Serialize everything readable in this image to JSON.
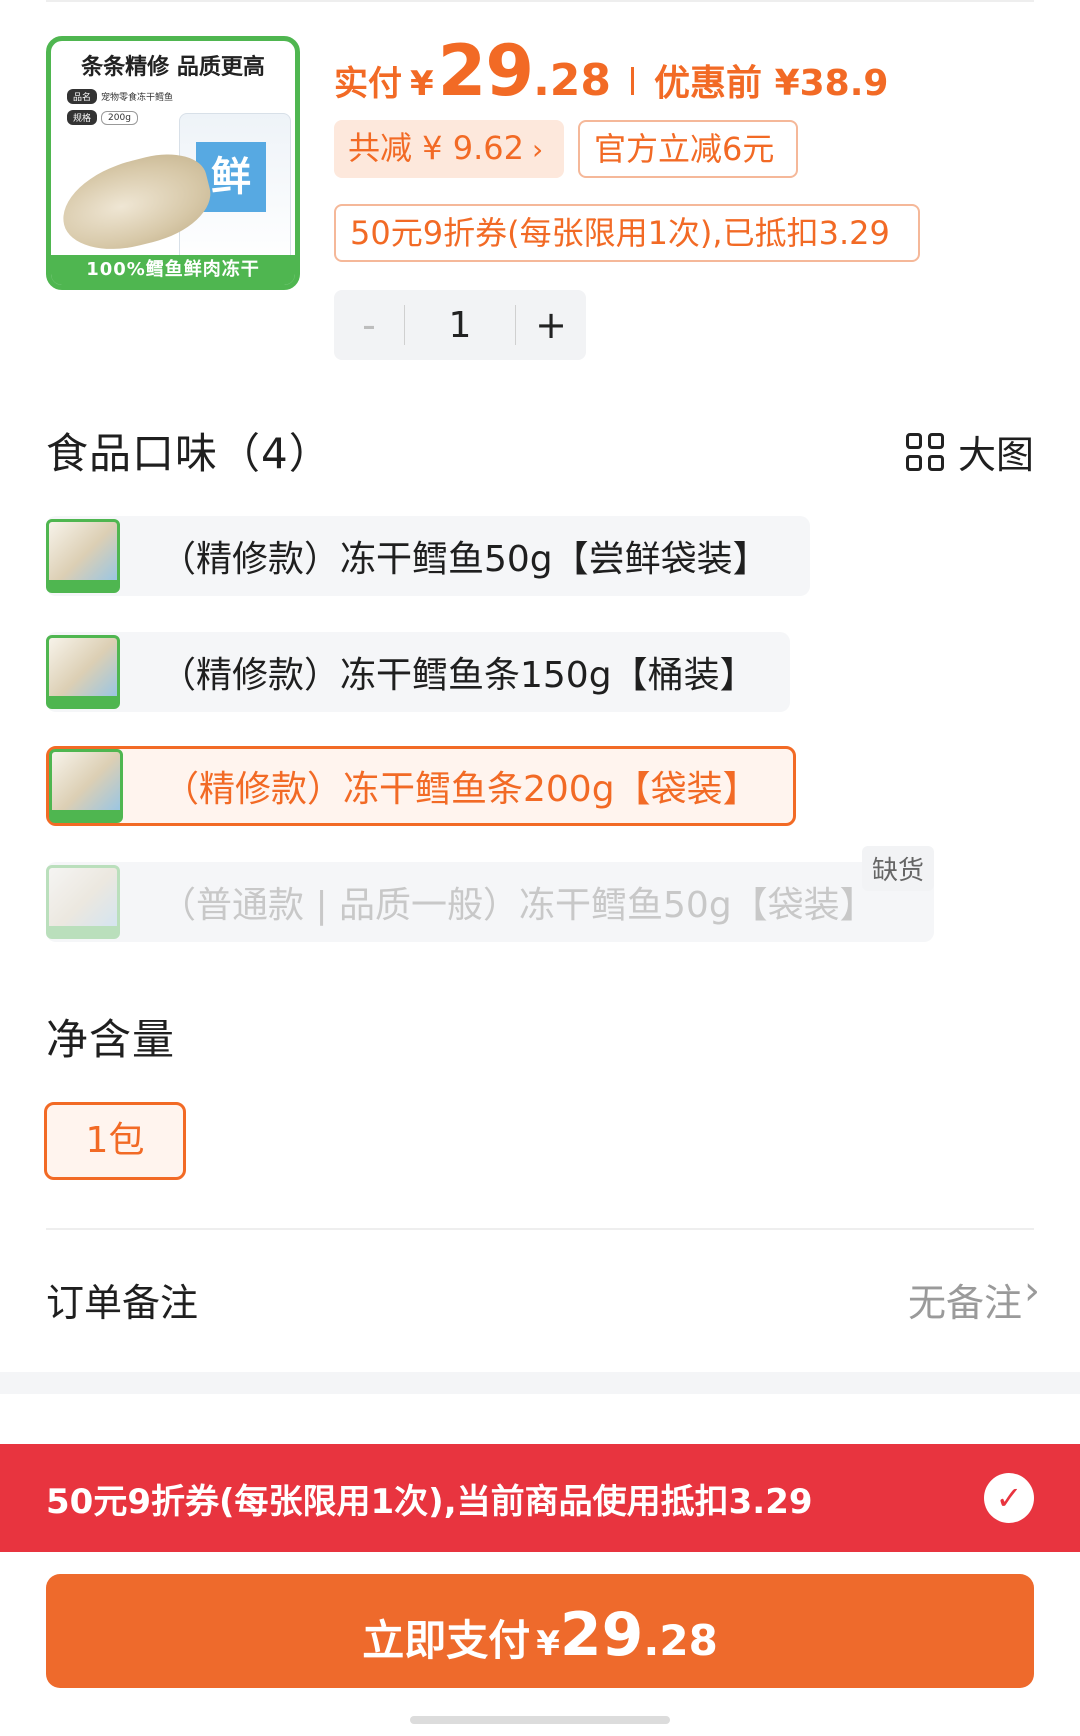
{
  "product": {
    "thumb_title": "条条精修 品质更高",
    "thumb_tag1_key": "品名",
    "thumb_tag1_val": "宠物零食冻干鳕鱼",
    "thumb_tag2_key": "规格",
    "thumb_tag2_val": "200g",
    "thumb_bag_char": "鲜",
    "thumb_footer": "100%鳕鱼鲜肉冻干"
  },
  "price": {
    "label": "实付",
    "currency": "¥",
    "integer": "29",
    "decimal": ".28",
    "original": "优惠前 ¥38.9",
    "total_discount": "共减 ¥ 9.62",
    "official_discount": "官方立减6元",
    "coupon_applied": "50元9折券(每张限用1次),已抵扣3.29"
  },
  "quantity": {
    "minus": "-",
    "value": "1",
    "plus": "+"
  },
  "flavor": {
    "title": "食品口味（4）",
    "big_view_label": "大图",
    "options": [
      {
        "label": "（精修款）冻干鳕鱼50g【尝鲜袋装】",
        "state": "normal"
      },
      {
        "label": "（精修款）冻干鳕鱼条150g【桶装】",
        "state": "normal"
      },
      {
        "label": "（精修款）冻干鳕鱼条200g【袋装】",
        "state": "selected"
      },
      {
        "label": "（普通款 | 品质一般）冻干鳕鱼50g【袋装】",
        "state": "disabled",
        "badge": "缺货"
      }
    ]
  },
  "net": {
    "title": "净含量",
    "option": "1包"
  },
  "remark": {
    "label": "订单备注",
    "value": "无备注"
  },
  "coupon_bar": {
    "text": "50元9折券(每张限用1次),当前商品使用抵扣3.29",
    "checked": true
  },
  "pay": {
    "label": "立即支付",
    "currency": "¥",
    "integer": "29",
    "decimal": ".28"
  },
  "colors": {
    "accent": "#f26a25",
    "coupon_bar": "#e8343f",
    "pay_button": "#ee6a2c",
    "brand_green": "#4fb650"
  },
  "icons": {
    "grid": "grid-icon",
    "chevron": "chevron-right-icon",
    "check": "check-circle-icon"
  }
}
